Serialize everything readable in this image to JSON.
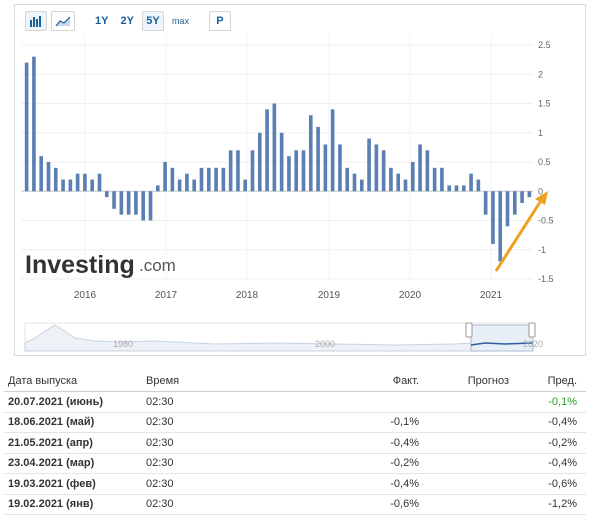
{
  "toolbar": {
    "bar_chart_icon": "bar-chart-icon",
    "area_chart_icon": "area-chart-icon",
    "ranges": [
      "1Y",
      "2Y",
      "5Y",
      "max"
    ],
    "active_range": "5Y",
    "p_button": "P"
  },
  "watermark": {
    "brand": "Investing",
    "suffix": ".com"
  },
  "chart_data": {
    "type": "bar",
    "color": "#5b7fb3",
    "arrow_color": "#f0a020",
    "y_ticks": [
      "2.5",
      "2",
      "1.5",
      "1",
      "0.5",
      "0",
      "-0.5",
      "-1",
      "-1.5"
    ],
    "ylim": [
      -1.5,
      2.5
    ],
    "x_ticks": [
      "2016",
      "2017",
      "2018",
      "2019",
      "2020",
      "2021"
    ],
    "values": [
      2.2,
      2.3,
      0.6,
      0.5,
      0.4,
      0.2,
      0.2,
      0.3,
      0.3,
      0.2,
      0.3,
      -0.1,
      -0.3,
      -0.4,
      -0.4,
      -0.4,
      -0.5,
      -0.5,
      0.1,
      0.5,
      0.4,
      0.2,
      0.3,
      0.2,
      0.4,
      0.4,
      0.4,
      0.4,
      0.7,
      0.7,
      0.2,
      0.7,
      1.0,
      1.4,
      1.5,
      1.0,
      0.6,
      0.7,
      0.7,
      1.3,
      1.1,
      0.8,
      1.4,
      0.8,
      0.4,
      0.3,
      0.2,
      0.9,
      0.8,
      0.7,
      0.4,
      0.3,
      0.2,
      0.5,
      0.8,
      0.7,
      0.4,
      0.4,
      0.1,
      0.1,
      0.1,
      0.3,
      0.2,
      -0.4,
      -0.9,
      -1.2,
      -0.6,
      -0.4,
      -0.2,
      -0.1
    ]
  },
  "navigator": {
    "labels": [
      "1980",
      "2000",
      "2020"
    ]
  },
  "table": {
    "headers": {
      "release_date": "Дата выпуска",
      "time": "Время",
      "actual": "Факт.",
      "forecast": "Прогноз",
      "previous": "Пред."
    },
    "rows": [
      {
        "date": "20.07.2021 (июнь)",
        "time": "02:30",
        "actual": "",
        "forecast": "",
        "previous": "-0,1%"
      },
      {
        "date": "18.06.2021 (май)",
        "time": "02:30",
        "actual": "-0,1%",
        "forecast": "",
        "previous": "-0,4%"
      },
      {
        "date": "21.05.2021 (апр)",
        "time": "02:30",
        "actual": "-0,4%",
        "forecast": "",
        "previous": "-0,2%"
      },
      {
        "date": "23.04.2021 (мар)",
        "time": "02:30",
        "actual": "-0,2%",
        "forecast": "",
        "previous": "-0,4%"
      },
      {
        "date": "19.03.2021 (фев)",
        "time": "02:30",
        "actual": "-0,4%",
        "forecast": "",
        "previous": "-0,6%"
      },
      {
        "date": "19.02.2021 (янв)",
        "time": "02:30",
        "actual": "-0,6%",
        "forecast": "",
        "previous": "-1,2%"
      }
    ]
  }
}
